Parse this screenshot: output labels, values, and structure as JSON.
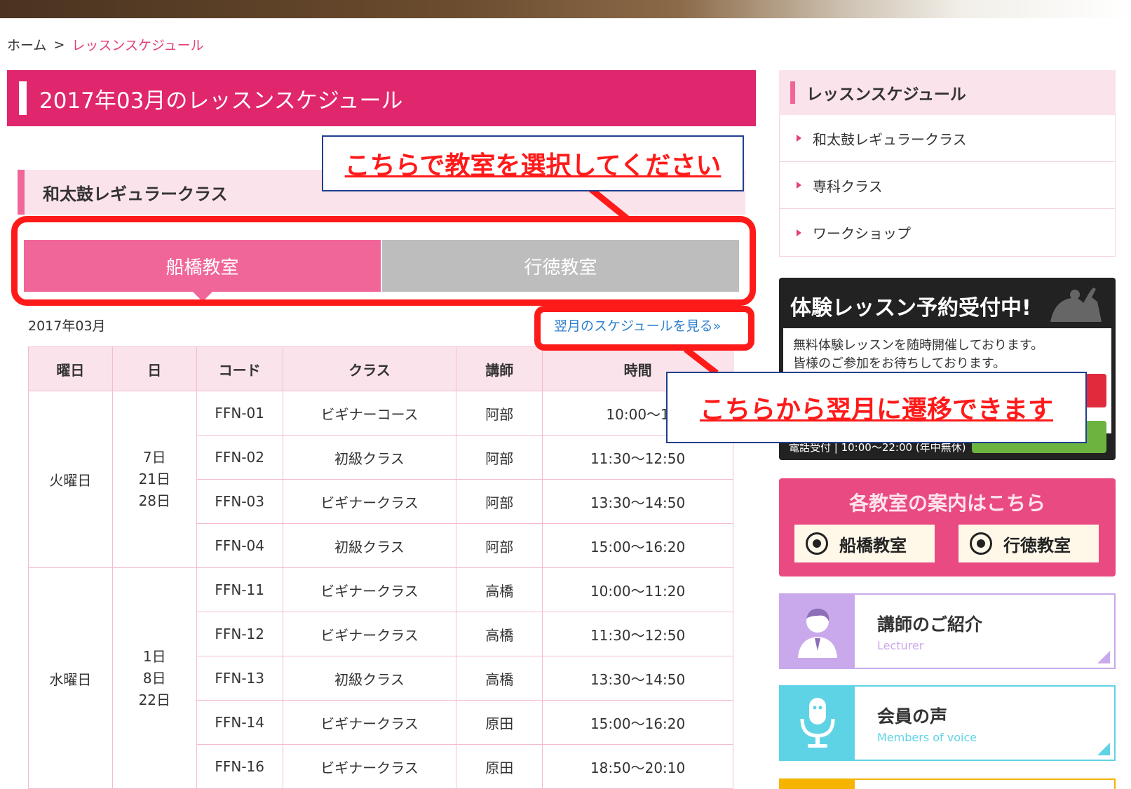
{
  "breadcrumb": {
    "home": "ホーム",
    "sep": ">",
    "current": "レッスンスケジュール"
  },
  "page_title": "2017年03月のレッスンスケジュール",
  "section_title": "和太鼓レギュラークラス",
  "tabs": [
    {
      "label": "船橋教室",
      "active": true
    },
    {
      "label": "行徳教室",
      "active": false
    }
  ],
  "month_label": "2017年03月",
  "next_link": "翌月のスケジュールを見る»",
  "table": {
    "headers": [
      "曜日",
      "日",
      "コード",
      "クラス",
      "講師",
      "時間"
    ],
    "groups": [
      {
        "weekday": "火曜日",
        "days": "7日\n21日\n28日",
        "rows": [
          {
            "code": "FFN-01",
            "class": "ビギナーコース",
            "teacher": "阿部",
            "time": "10:00〜1"
          },
          {
            "code": "FFN-02",
            "class": "初級クラス",
            "teacher": "阿部",
            "time": "11:30〜12:50"
          },
          {
            "code": "FFN-03",
            "class": "ビギナークラス",
            "teacher": "阿部",
            "time": "13:30〜14:50"
          },
          {
            "code": "FFN-04",
            "class": "初級クラス",
            "teacher": "阿部",
            "time": "15:00〜16:20"
          }
        ]
      },
      {
        "weekday": "水曜日",
        "days": "1日\n8日\n22日",
        "rows": [
          {
            "code": "FFN-11",
            "class": "ビギナークラス",
            "teacher": "高橋",
            "time": "10:00〜11:20"
          },
          {
            "code": "FFN-12",
            "class": "ビギナークラス",
            "teacher": "高橋",
            "time": "11:30〜12:50"
          },
          {
            "code": "FFN-13",
            "class": "初級クラス",
            "teacher": "高橋",
            "time": "13:30〜14:50"
          },
          {
            "code": "FFN-14",
            "class": "ビギナークラス",
            "teacher": "原田",
            "time": "15:00〜16:20"
          },
          {
            "code": "FFN-16",
            "class": "ビギナークラス",
            "teacher": "原田",
            "time": "18:50〜20:10"
          }
        ]
      }
    ]
  },
  "sidebar": {
    "title": "レッスンスケジュール",
    "items": [
      {
        "label": "和太鼓レギュラークラス"
      },
      {
        "label": "専科クラス"
      },
      {
        "label": "ワークショップ"
      }
    ]
  },
  "trial": {
    "title": "体験レッスン予約受付中!",
    "line1": "無料体験レッスンを随時開催しております。",
    "line2": "皆様のご参加をお待ちしております。",
    "phone_hours": "電話受付 | 10:00〜22:00 (年中無休)"
  },
  "classrooms": {
    "title": "各教室の案内はこちら",
    "buttons": [
      {
        "label": "船橋教室"
      },
      {
        "label": "行徳教室"
      }
    ]
  },
  "cards": [
    {
      "title": "講師のご紹介",
      "subtitle": "Lecturer",
      "color": "#c9a9ec",
      "icon": "lecturer-icon"
    },
    {
      "title": "会員の声",
      "subtitle": "Members of voice",
      "color": "#5fd3e6",
      "icon": "microphone-icon"
    }
  ],
  "annotations": {
    "select_classroom": "こちらで教室を選択してください",
    "next_month": "こちらから翌月に遷移できます"
  },
  "colors": {
    "pink": "#e0266d",
    "light_pink": "#fbe3eb",
    "tab_pink": "#f06699",
    "tab_gray": "#bdbdbd",
    "annotation_red": "#ff1a1a",
    "link_blue": "#2e7fcf"
  }
}
